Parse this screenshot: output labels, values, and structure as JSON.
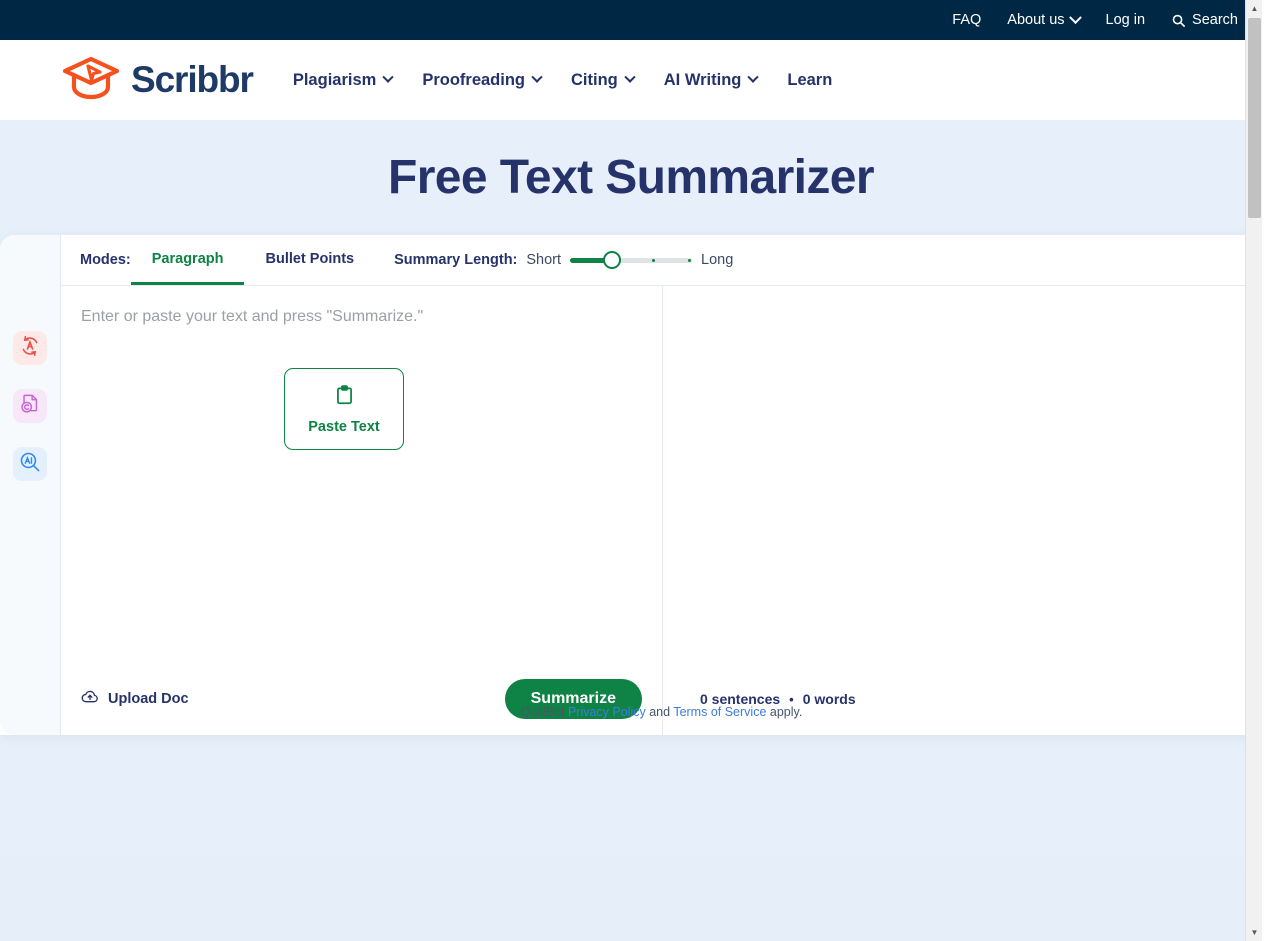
{
  "topbar": {
    "items": [
      {
        "label": "FAQ",
        "icon": null,
        "caret": false
      },
      {
        "label": "About us",
        "icon": null,
        "caret": true
      },
      {
        "label": "Log in",
        "icon": null,
        "caret": false
      },
      {
        "label": "Search",
        "icon": "search-icon",
        "caret": false
      }
    ]
  },
  "brand": {
    "name": "Scribbr",
    "logo_icon": "graduation-cap-cursor-icon",
    "logo_color": "#f4511e",
    "text_color": "#1e3a66"
  },
  "nav": {
    "items": [
      {
        "label": "Plagiarism",
        "caret": true
      },
      {
        "label": "Proofreading",
        "caret": true
      },
      {
        "label": "Citing",
        "caret": true
      },
      {
        "label": "AI Writing",
        "caret": true
      },
      {
        "label": "Learn",
        "caret": false
      }
    ]
  },
  "hero": {
    "title": "Free Text Summarizer"
  },
  "rail": {
    "items": [
      {
        "name": "paraphraser",
        "icon": "circular-arrows-a-icon",
        "color": "#e8524a",
        "bg": "#fdeae8"
      },
      {
        "name": "citation-generator",
        "icon": "document-c-icon",
        "color": "#c765d4",
        "bg": "#f8e7f8"
      },
      {
        "name": "ai-detector",
        "icon": "ai-magnifier-icon",
        "color": "#2b8af0",
        "bg": "#e4f0fd"
      }
    ]
  },
  "toolbar": {
    "modes_label": "Modes:",
    "modes": [
      {
        "label": "Paragraph",
        "active": true
      },
      {
        "label": "Bullet Points",
        "active": false
      }
    ],
    "length_label": "Summary Length:",
    "length_min": "Short",
    "length_max": "Long",
    "length_value": 1,
    "length_steps": 4,
    "accent_color": "#0e8345"
  },
  "editor": {
    "placeholder": "Enter or paste your text and press \"Summarize.\"",
    "paste_button": {
      "label": "Paste Text",
      "icon": "clipboard-icon"
    }
  },
  "footer": {
    "upload_label": "Upload Doc",
    "upload_icon": "cloud-upload-icon",
    "summarize_label": "Summarize",
    "sentences_count": "0 sentences",
    "separator": "•",
    "words_count": "0 words"
  },
  "legal": {
    "prefix": "QuillBot ",
    "privacy_link": "Privacy Policy",
    "middle": " and ",
    "terms_link": "Terms of Service",
    "suffix": " apply."
  }
}
